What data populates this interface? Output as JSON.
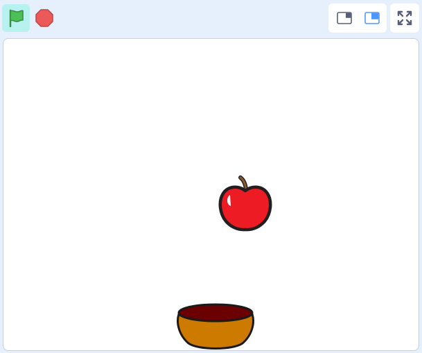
{
  "toolbar": {
    "green_flag_icon": "green-flag-icon",
    "stop_icon": "stop-sign-icon",
    "small_stage_icon": "small-stage-layout-icon",
    "normal_stage_icon": "normal-stage-layout-icon",
    "fullscreen_icon": "fullscreen-icon"
  },
  "colors": {
    "background": "#e6effc",
    "flag_active": "#b8f2f0",
    "flag": "#4cbf56",
    "stop": "#ec5959",
    "accent": "#4c97ff",
    "icon_gray": "#575e75"
  },
  "stage": {
    "sprites": [
      {
        "name": "Apple",
        "icon": "apple-icon"
      },
      {
        "name": "Bowl",
        "icon": "bowl-icon"
      }
    ]
  }
}
